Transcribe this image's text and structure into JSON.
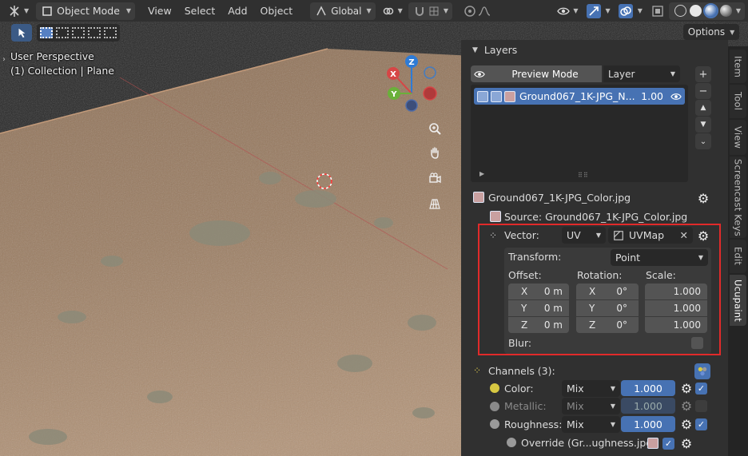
{
  "header": {
    "mode_label": "Object Mode",
    "menus": [
      "View",
      "Select",
      "Add",
      "Object"
    ],
    "orientation_label": "Global",
    "options_label": "Options"
  },
  "viewport": {
    "perspective_label": "User Perspective",
    "collection_label": "(1) Collection | Plane",
    "gizmo": {
      "z": "Z",
      "x": "X",
      "y": "Y"
    }
  },
  "sidebar": {
    "layers_title": "Layers",
    "preview_mode_label": "Preview Mode",
    "layer_dropdown": "Layer",
    "layer_item": {
      "name": "Ground067_1K-JPG_N...",
      "value": "1.00"
    },
    "image_name": "Ground067_1K-JPG_Color.jpg",
    "source_label": "Source: Ground067_1K-JPG_Color.jpg",
    "vector": {
      "label": "Vector:",
      "mode": "UV",
      "uvmap": "UVMap",
      "transform_label": "Transform:",
      "transform_value": "Point",
      "offset_label": "Offset:",
      "rotation_label": "Rotation:",
      "scale_label": "Scale:",
      "offset": [
        {
          "axis": "X",
          "value": "0 m"
        },
        {
          "axis": "Y",
          "value": "0 m"
        },
        {
          "axis": "Z",
          "value": "0 m"
        }
      ],
      "rotation": [
        {
          "axis": "X",
          "value": "0°"
        },
        {
          "axis": "Y",
          "value": "0°"
        },
        {
          "axis": "Z",
          "value": "0°"
        }
      ],
      "scale": [
        "1.000",
        "1.000",
        "1.000"
      ],
      "blur_label": "Blur:"
    },
    "channels": {
      "title": "Channels (3):",
      "rows": [
        {
          "label": "Color:",
          "blend": "Mix",
          "value": "1.000",
          "enabled": true,
          "dot_color": "#d7c842"
        },
        {
          "label": "Metallic:",
          "blend": "Mix",
          "value": "1.000",
          "enabled": false,
          "dot_color": "#8a8a8a"
        },
        {
          "label": "Roughness:",
          "blend": "Mix",
          "value": "1.000",
          "enabled": true,
          "dot_color": "#9a9a9a"
        }
      ],
      "override_label": "Override (Gr...ughness.jpg):"
    }
  },
  "tabs": [
    "Item",
    "Tool",
    "View",
    "Screencast Keys",
    "Edit",
    "Ucupaint"
  ]
}
